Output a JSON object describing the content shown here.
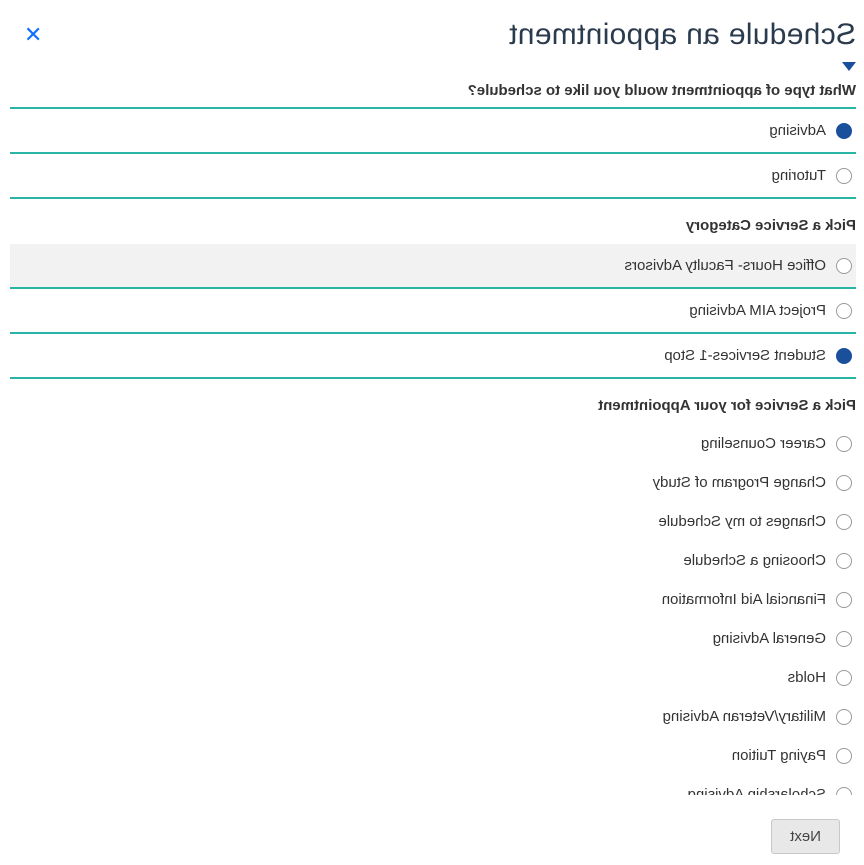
{
  "header": {
    "title": "Schedule an appointment"
  },
  "sections": {
    "appointmentType": {
      "heading": "What type of appointment would you like to schedule?",
      "options": [
        {
          "label": "Advising",
          "selected": true
        },
        {
          "label": "Tutoring",
          "selected": false
        }
      ]
    },
    "serviceCategory": {
      "heading": "Pick a Service Category",
      "options": [
        {
          "label": "Office Hours- Faculty Advisors",
          "selected": false,
          "highlighted": true
        },
        {
          "label": "Project AIM Advising",
          "selected": false
        },
        {
          "label": "Student Services-1 Stop",
          "selected": true
        }
      ]
    },
    "service": {
      "heading": "Pick a Service for your Appointment",
      "options": [
        {
          "label": "Career Counseling",
          "selected": false
        },
        {
          "label": "Change Program of Study",
          "selected": false
        },
        {
          "label": "Changes to my Schedule",
          "selected": false
        },
        {
          "label": "Choosing a Schedule",
          "selected": false
        },
        {
          "label": "Financial Aid Information",
          "selected": false
        },
        {
          "label": "General Advising",
          "selected": false
        },
        {
          "label": "Holds",
          "selected": false
        },
        {
          "label": "Military/Veteran Advising",
          "selected": false
        },
        {
          "label": "Paying Tuition",
          "selected": false
        },
        {
          "label": "Scholarship Advising",
          "selected": false
        }
      ]
    }
  },
  "footer": {
    "nextLabel": "Next"
  }
}
